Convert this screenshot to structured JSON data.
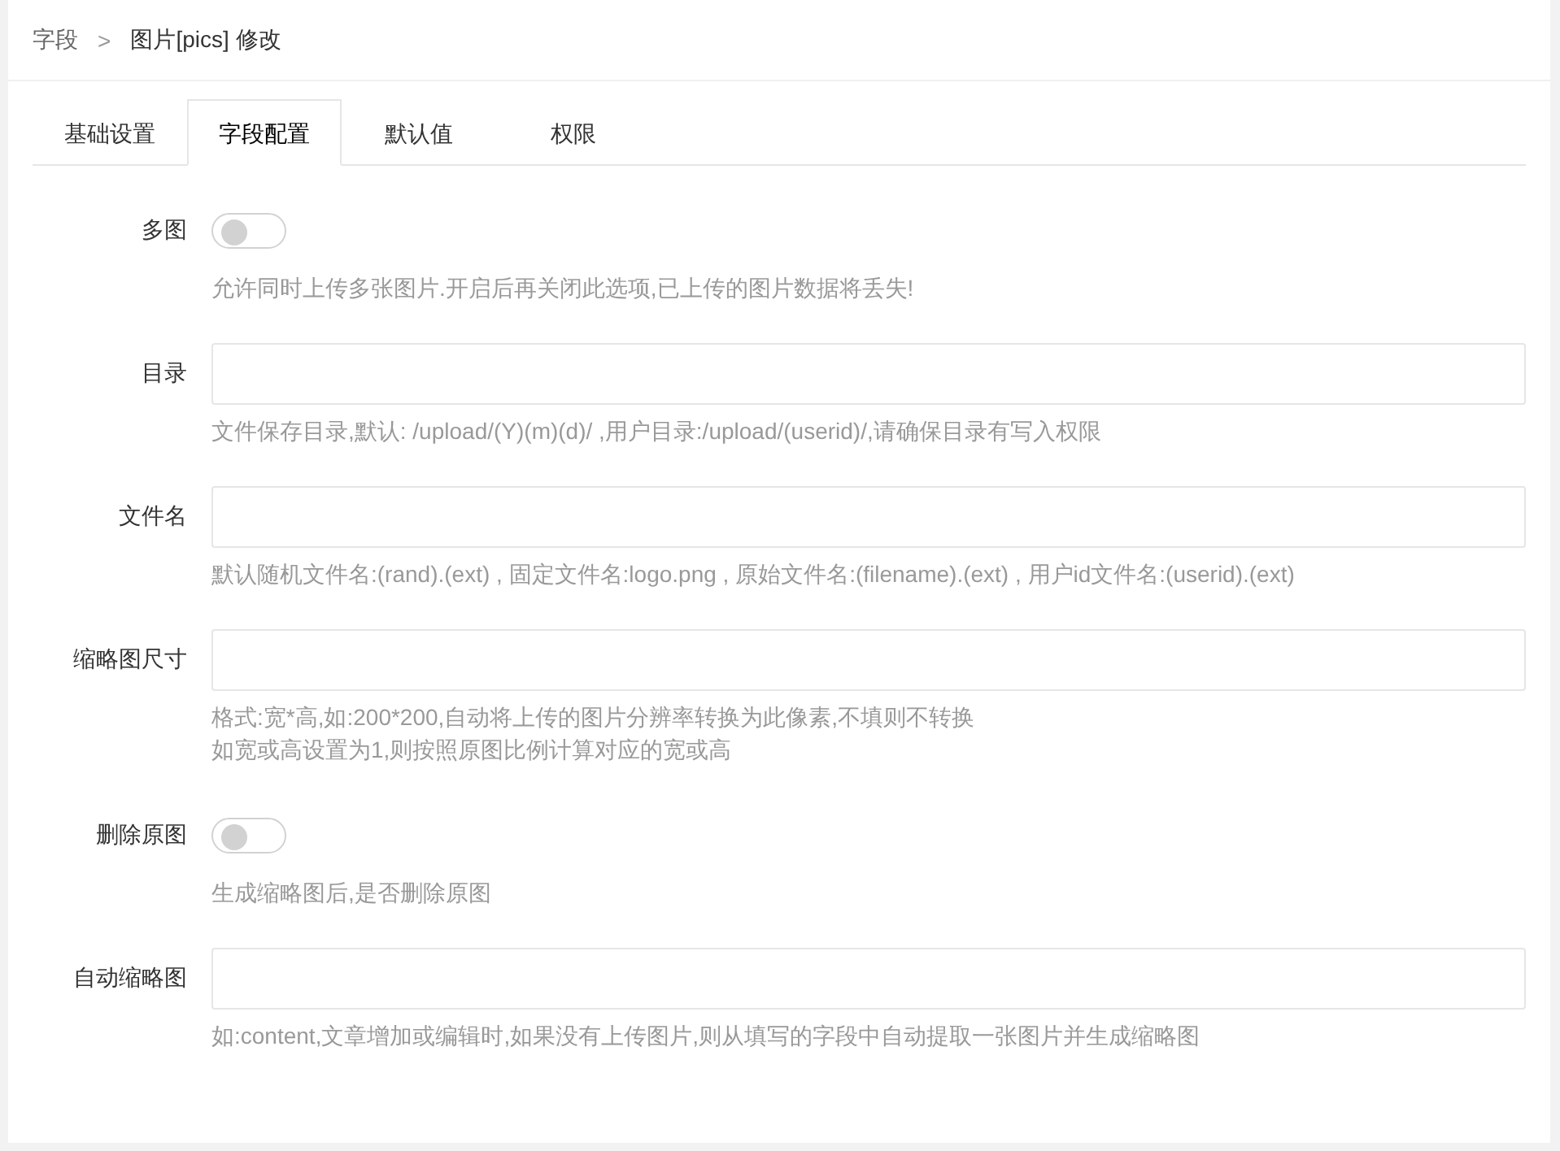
{
  "breadcrumb": {
    "parent": "字段",
    "separator": ">",
    "current": "图片[pics] 修改"
  },
  "tabs": [
    {
      "label": "基础设置",
      "selected": false
    },
    {
      "label": "字段配置",
      "selected": true
    },
    {
      "label": "默认值",
      "selected": false
    },
    {
      "label": "权限",
      "selected": false
    }
  ],
  "fields": [
    {
      "kind": "switch",
      "label": "多图",
      "on": false,
      "hints": [
        "允许同时上传多张图片.开启后再关闭此选项,已上传的图片数据将丢失!"
      ]
    },
    {
      "kind": "text",
      "label": "目录",
      "hints": [
        "文件保存目录,默认: /upload/(Y)(m)(d)/ ,用户目录:/upload/(userid)/,请确保目录有写入权限"
      ]
    },
    {
      "kind": "text",
      "label": "文件名",
      "hints": [
        "默认随机文件名:(rand).(ext) , 固定文件名:logo.png , 原始文件名:(filename).(ext) , 用户id文件名:(userid).(ext)"
      ]
    },
    {
      "kind": "text",
      "label": "缩略图尺寸",
      "hints": [
        "格式:宽*高,如:200*200,自动将上传的图片分辨率转换为此像素,不填则不转换",
        "如宽或高设置为1,则按照原图比例计算对应的宽或高"
      ]
    },
    {
      "kind": "switch",
      "label": "删除原图",
      "on": false,
      "hints": [
        "生成缩略图后,是否删除原图"
      ]
    },
    {
      "kind": "text",
      "label": "自动缩略图",
      "hints": [
        "如:content,文章增加或编辑时,如果没有上传图片,则从填写的字段中自动提取一张图片并生成缩略图"
      ]
    }
  ]
}
